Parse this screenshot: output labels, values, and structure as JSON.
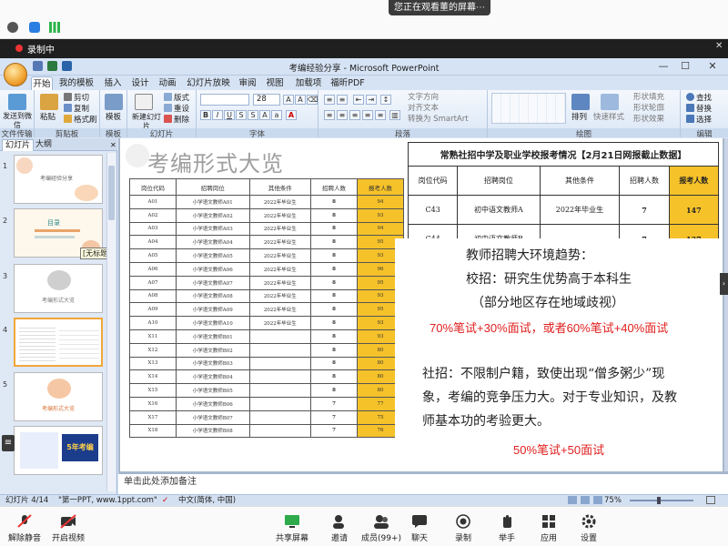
{
  "share_banner": {
    "text": "您正在观看董的屏幕",
    "grip": "⋯"
  },
  "recording": {
    "label": "录制中"
  },
  "window": {
    "title": "考编经验分享 - Microsoft PowerPoint",
    "minimize": "—",
    "maximize": "☐",
    "close": "✕"
  },
  "ribbon_tabs": [
    "开始",
    "我的模板",
    "插入",
    "设计",
    "动画",
    "幻灯片放映",
    "审阅",
    "视图",
    "加载项",
    "福昕PDF"
  ],
  "ribbon": {
    "broadcast": "发送到微信",
    "clipboard": {
      "paste": "粘贴",
      "cut": "剪切",
      "copy": "复制",
      "painter": "格式刷",
      "label": "剪贴板"
    },
    "template": {
      "label": "模板",
      "btn": "模板"
    },
    "slides": {
      "new": "新建幻灯片",
      "layout": "版式",
      "reset": "重设",
      "delete": "删除",
      "label": "幻灯片"
    },
    "font": {
      "label": "字体",
      "size": "28"
    },
    "paragraph": {
      "label": "段落",
      "direction": "文字方向",
      "align": "对齐文本",
      "smartart": "转换为 SmartArt"
    },
    "drawing": {
      "label": "绘图",
      "arrange": "排列",
      "quickstyle": "快速样式",
      "fill": "形状填充",
      "outline": "形状轮廓",
      "effect": "形状效果"
    },
    "editing": {
      "label": "编辑",
      "find": "查找",
      "replace": "替换",
      "select": "选择"
    },
    "file_label": "文件传输",
    "file_btn": "发送到微信"
  },
  "panel": {
    "tab_slides": "幻灯片",
    "tab_outline": "大纲",
    "tooltip": "[无标题]"
  },
  "thumbnails": [
    {
      "num": "1",
      "title": "考编经验分享"
    },
    {
      "num": "2",
      "title": "目录"
    },
    {
      "num": "3",
      "title": "考编形式大览"
    },
    {
      "num": "4",
      "title": ""
    },
    {
      "num": "5",
      "title": "考编形式大览"
    },
    {
      "num": "6",
      "title": "5年考编"
    }
  ],
  "slide": {
    "heading": "考编形式大览",
    "left_table": {
      "headers": [
        "岗位代码",
        "招聘岗位",
        "其他条件",
        "招聘人数",
        "报考人数"
      ],
      "rows": [
        [
          "A01",
          "小学语文教师A01",
          "2022年毕业生",
          "8",
          "94"
        ],
        [
          "A02",
          "小学语文教师A02",
          "2022年毕业生",
          "8",
          "93"
        ],
        [
          "A03",
          "小学语文教师A03",
          "2022年毕业生",
          "8",
          "94"
        ],
        [
          "A04",
          "小学语文教师A04",
          "2022年毕业生",
          "8",
          "95"
        ],
        [
          "A05",
          "小学语文教师A05",
          "2022年毕业生",
          "8",
          "93"
        ],
        [
          "A06",
          "小学语文教师A06",
          "2022年毕业生",
          "8",
          "96"
        ],
        [
          "A07",
          "小学语文教师A07",
          "2022年毕业生",
          "8",
          "95"
        ],
        [
          "A08",
          "小学语文教师A08",
          "2022年毕业生",
          "8",
          "93"
        ],
        [
          "A09",
          "小学语文教师A09",
          "2022年毕业生",
          "8",
          "95"
        ],
        [
          "A10",
          "小学语文教师A10",
          "2022年毕业生",
          "8",
          "93"
        ],
        [
          "X11",
          "小学语文教师B01",
          "",
          "8",
          "93"
        ],
        [
          "X12",
          "小学语文教师B02",
          "",
          "8",
          "80"
        ],
        [
          "X13",
          "小学语文教师B03",
          "",
          "8",
          "80"
        ],
        [
          "X14",
          "小学语文教师B04",
          "",
          "8",
          "80"
        ],
        [
          "X15",
          "小学语文教师B05",
          "",
          "8",
          "80"
        ],
        [
          "X16",
          "小学语文教师B06",
          "",
          "7",
          "77"
        ],
        [
          "X17",
          "小学语文教师B07",
          "",
          "7",
          "75"
        ],
        [
          "X18",
          "小学语文教师B08",
          "",
          "7",
          "76"
        ]
      ]
    },
    "right_table": {
      "caption": "常熟社招中学及职业学校报考情况【2月21日网报截止数据】",
      "headers": [
        "岗位代码",
        "招聘岗位",
        "其他条件",
        "招聘人数",
        "报考人数"
      ],
      "rows": [
        [
          "C43",
          "初中语文教师A",
          "2022年毕业生",
          "7",
          "147"
        ],
        [
          "C44",
          "初中语文教师B",
          "",
          "7",
          "137"
        ]
      ]
    },
    "overlay": {
      "line1": "教师招聘大环境趋势：",
      "line2": "校招：研究生优势高于本科生",
      "line3": "（部分地区存在地域歧视）",
      "line4": "70%笔试+30%面试，或者60%笔试+40%面试",
      "line5": "社招：不限制户籍，致使出现“僧多粥少”现",
      "line6": "象，考编的竞争压力大。对于专业知识，及教",
      "line7": "师基本功的考验更大。",
      "line8": "50%笔试+50面试"
    }
  },
  "notes": "单击此处添加备注",
  "status": {
    "slide": "幻灯片 4/14",
    "theme": "\"第一PPT, www.1ppt.com\"",
    "lang": "中文(简体, 中国)",
    "zoom": "75%"
  },
  "meeting_bar": {
    "mute": "解除静音",
    "video": "开启视频",
    "share": "共享屏幕",
    "invite": "邀请",
    "members": "成员(99+)",
    "chat": "聊天",
    "record": "录制",
    "hand": "举手",
    "apps": "应用",
    "settings": "设置"
  }
}
